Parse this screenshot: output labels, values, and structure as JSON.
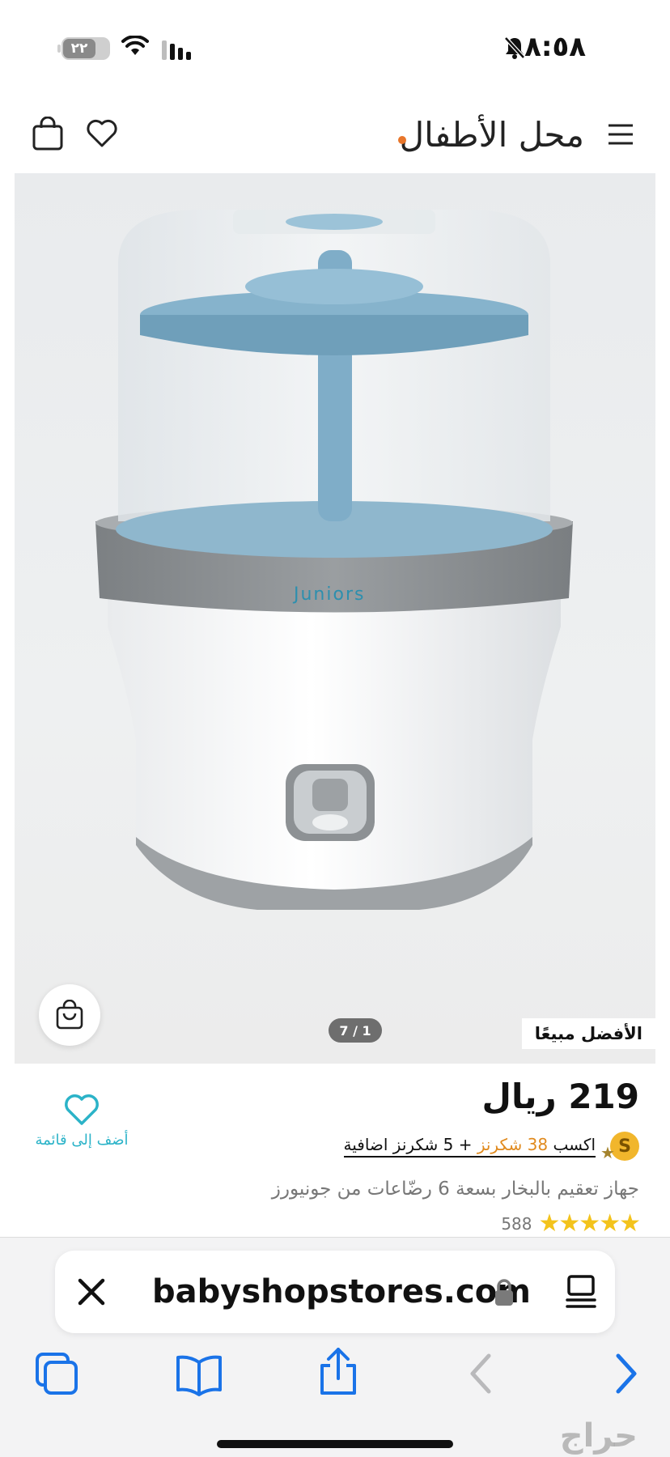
{
  "status": {
    "time": "٨:٥٨",
    "battery": "٢٢"
  },
  "header": {
    "logo": "محل الأطفال"
  },
  "gallery": {
    "pager": "7 / 1",
    "badge": "الأفضل مبيعًا",
    "brand_on_product": "Juniors"
  },
  "product": {
    "price": "219 ريال",
    "points_prefix": "اكسب",
    "points_highlight": "38 شكرنز",
    "points_suffix": "+ 5 شكرنز اضافية",
    "title": "جهاز تعقيم بالبخار بسعة 6 رضّاعات من جونيورز",
    "rating_count": "588",
    "stars": "★★★★★",
    "coin_letter": "S"
  },
  "wishlist": {
    "label": "أضف إلى قائمة"
  },
  "browser": {
    "url": "babyshopstores.com"
  },
  "watermark": "حراج",
  "colors": {
    "accent_teal": "#2bb3c8",
    "star_yellow": "#f3c31c",
    "points_orange": "#e08a1e",
    "ios_blue": "#1a73e8"
  }
}
